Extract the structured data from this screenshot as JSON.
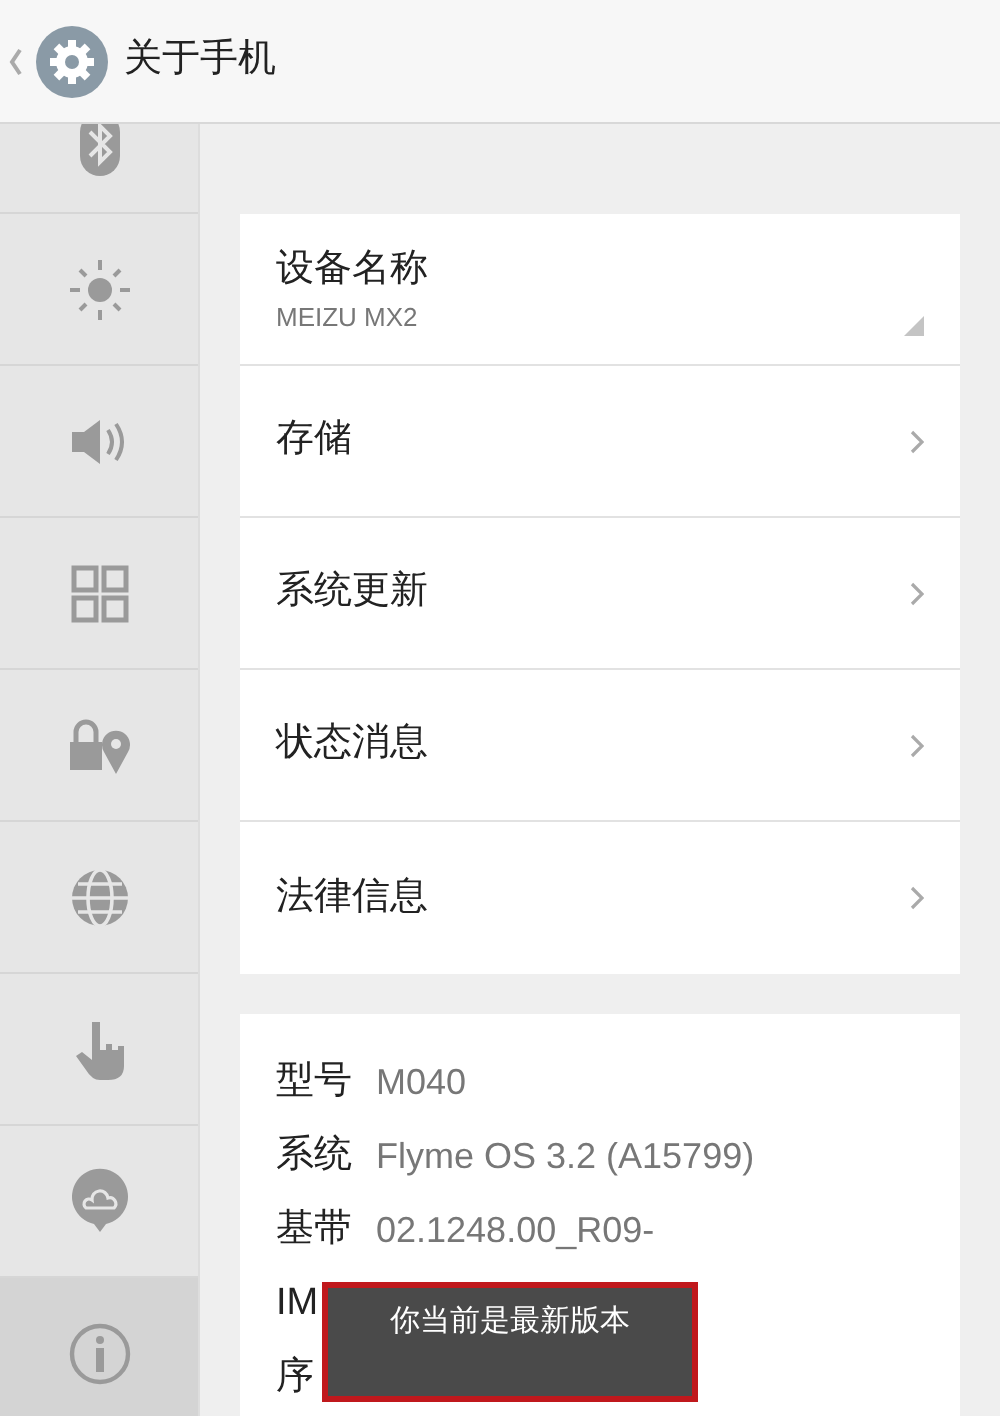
{
  "header": {
    "title": "关于手机"
  },
  "sidebar": {
    "items": [
      {
        "selected": false
      },
      {
        "selected": false
      },
      {
        "selected": false
      },
      {
        "selected": false
      },
      {
        "selected": false
      },
      {
        "selected": false
      },
      {
        "selected": false
      },
      {
        "selected": false
      },
      {
        "selected": true
      }
    ]
  },
  "settings": [
    {
      "title": "设备名称",
      "subtitle": "MEIZU MX2",
      "kind": "dropdown"
    },
    {
      "title": "存储",
      "kind": "link"
    },
    {
      "title": "系统更新",
      "kind": "link"
    },
    {
      "title": "状态消息",
      "kind": "link"
    },
    {
      "title": "法律信息",
      "kind": "link"
    }
  ],
  "info": [
    {
      "label": "型号",
      "value": "M040"
    },
    {
      "label": "系统",
      "value": "Flyme OS 3.2 (A15799)"
    },
    {
      "label": "基带",
      "value": "02.1248.00_R09-"
    },
    {
      "label": "IM"
    },
    {
      "label": "序"
    }
  ],
  "toast": {
    "text": "你当前是最新版本"
  }
}
